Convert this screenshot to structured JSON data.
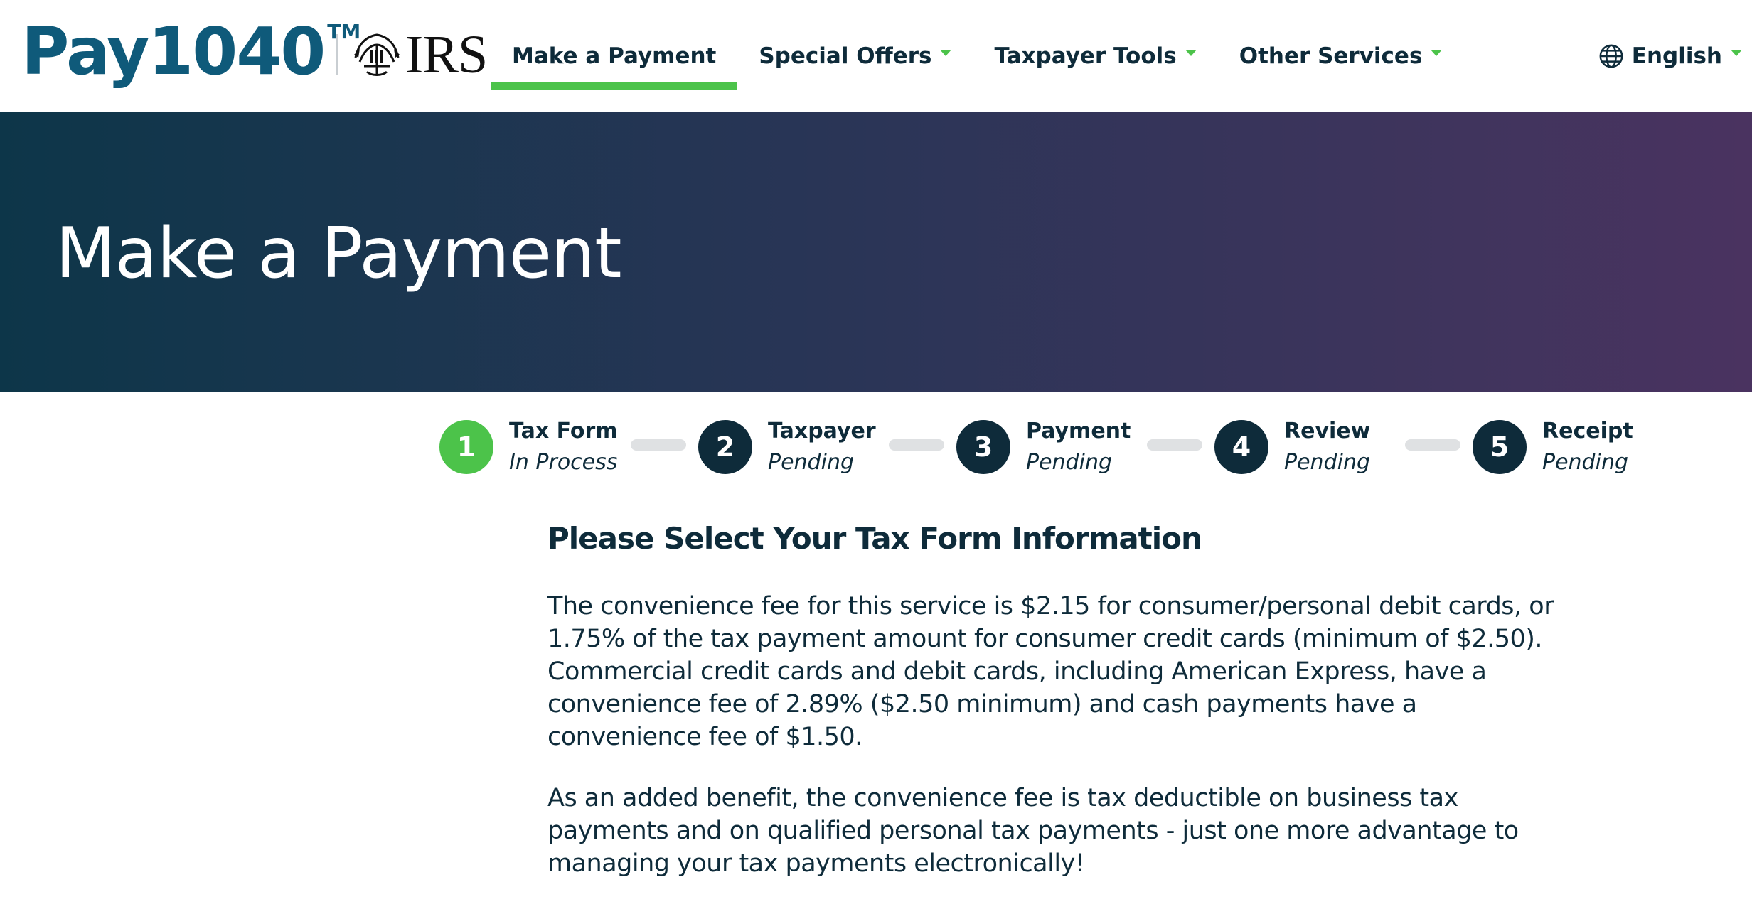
{
  "header": {
    "brand": "Pay1040",
    "brand_tm": "TM",
    "partner": "IRS",
    "nav": [
      {
        "label": "Make a Payment",
        "active": true,
        "dropdown": false
      },
      {
        "label": "Special Offers",
        "active": false,
        "dropdown": true
      },
      {
        "label": "Taxpayer Tools",
        "active": false,
        "dropdown": true
      },
      {
        "label": "Other Services",
        "active": false,
        "dropdown": true
      }
    ],
    "language": {
      "label": "English",
      "icon": "globe-icon"
    }
  },
  "hero": {
    "title": "Make a Payment"
  },
  "steps": [
    {
      "number": "1",
      "title": "Tax Form",
      "status": "In Process",
      "current": true
    },
    {
      "number": "2",
      "title": "Taxpayer",
      "status": "Pending",
      "current": false
    },
    {
      "number": "3",
      "title": "Payment",
      "status": "Pending",
      "current": false
    },
    {
      "number": "4",
      "title": "Review",
      "status": "Pending",
      "current": false
    },
    {
      "number": "5",
      "title": "Receipt",
      "status": "Pending",
      "current": false
    }
  ],
  "content": {
    "heading": "Please Select Your Tax Form Information",
    "paragraphs": [
      "The convenience fee for this service is $2.15 for consumer/personal debit cards, or 1.75% of the tax payment amount for consumer credit cards (minimum of $2.50). Commercial credit cards and debit cards, including American Express, have a convenience fee of 2.89% ($2.50 minimum) and cash payments have a convenience fee of $1.50.",
      "As an added benefit, the convenience fee is tax deductible on business tax payments and on qualified personal tax payments - just one more advantage to managing your tax payments electronically!"
    ]
  },
  "colors": {
    "brand": "#0f5a7a",
    "accent_green": "#4cc34a",
    "navy": "#0e2b3a",
    "hero_start": "#0d3649",
    "hero_end": "#4a3360"
  }
}
